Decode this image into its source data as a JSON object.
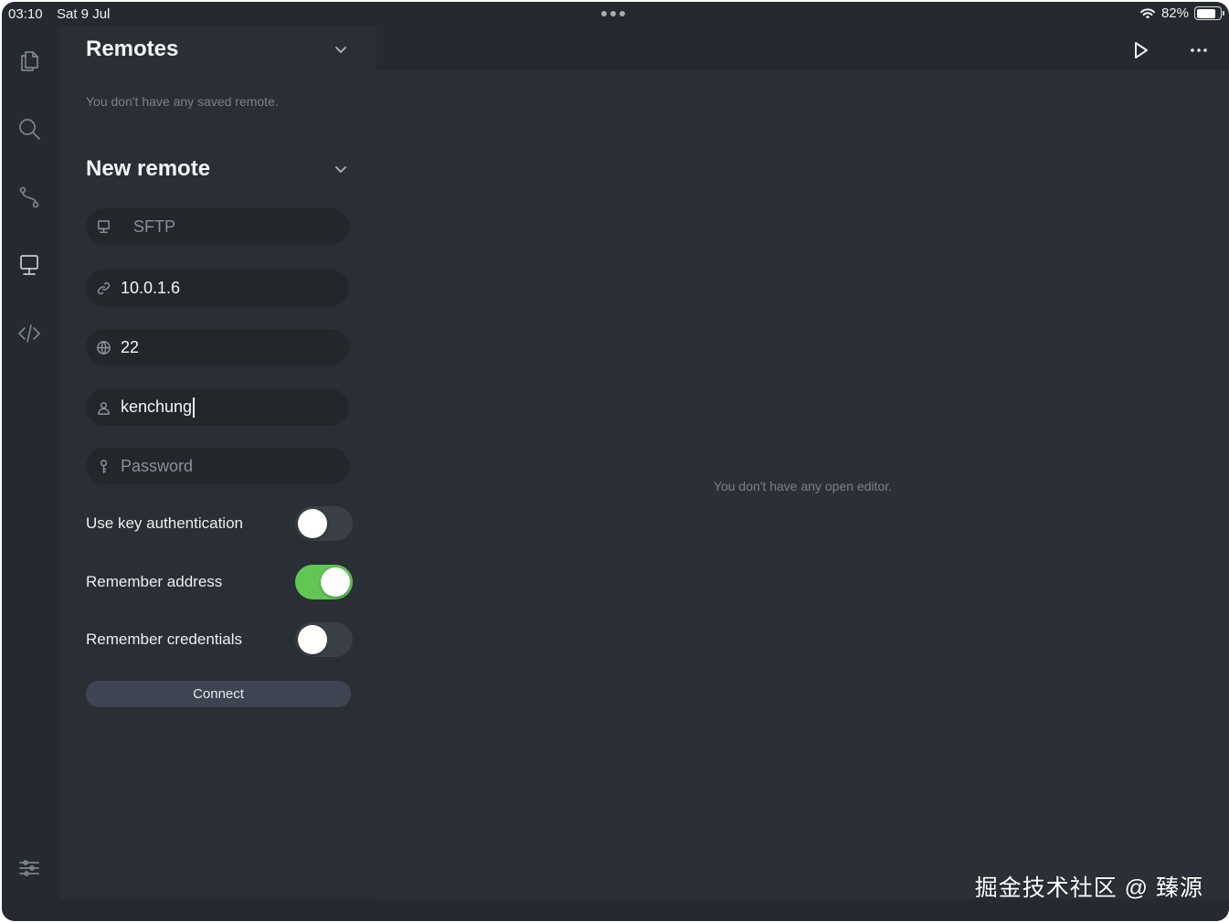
{
  "status_bar": {
    "time": "03:10",
    "date": "Sat 9 Jul",
    "battery_percent": "82%",
    "battery_level": 0.82
  },
  "activity_bar": {
    "items": [
      {
        "icon": "files-icon"
      },
      {
        "icon": "search-icon"
      },
      {
        "icon": "source-control-icon"
      },
      {
        "icon": "remote-icon"
      },
      {
        "icon": "code-icon"
      }
    ],
    "bottom_icon": "settings-sliders-icon"
  },
  "sidebar": {
    "remotes": {
      "title": "Remotes",
      "empty_message": "You don't have any saved remote."
    },
    "new_remote": {
      "title": "New remote",
      "protocol": "SFTP",
      "address": "10.0.1.6",
      "port": "22",
      "username": "kenchung",
      "password_placeholder": "Password",
      "toggles": [
        {
          "label": "Use key authentication",
          "on": false
        },
        {
          "label": "Remember address",
          "on": true
        },
        {
          "label": "Remember credentials",
          "on": false
        }
      ],
      "connect_label": "Connect"
    }
  },
  "editor": {
    "empty_message": "You don't have any open editor."
  },
  "watermark": "掘金技术社区 @ 臻源",
  "colors": {
    "toggle_on": "#62c655",
    "background": "#262a30",
    "connect_button": "#3d4552"
  }
}
